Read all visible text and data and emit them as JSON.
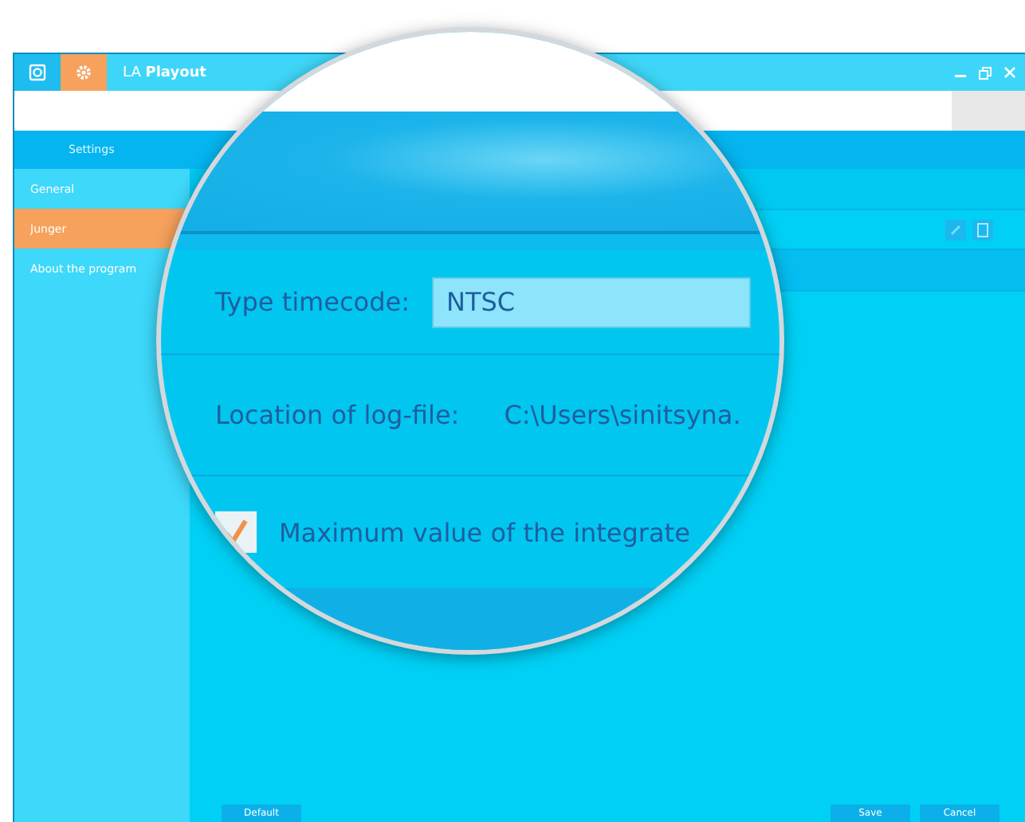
{
  "window": {
    "title": "LA **Playout**"
  },
  "app_tabs": [
    {
      "kind": "camera",
      "selected": false
    },
    {
      "kind": "gear",
      "selected": true
    }
  ],
  "section_title": "Settings",
  "sidebar": {
    "items": [
      {
        "label": "General",
        "selected": false
      },
      {
        "label": "Junger",
        "selected": true
      },
      {
        "label": "About the program",
        "selected": false
      }
    ]
  },
  "magnifier": {
    "timecode": {
      "label": "Type timecode:",
      "value": "NTSC"
    },
    "log_file": {
      "label": "Location of log-file:",
      "value": "C:\\Users\\sinitsyna."
    },
    "integrated": {
      "label": "Maximum value of the integrate",
      "checked": true
    }
  },
  "footer": {
    "left_buttons": [
      "Default"
    ],
    "right_buttons": [
      "Save",
      "Cancel"
    ]
  }
}
